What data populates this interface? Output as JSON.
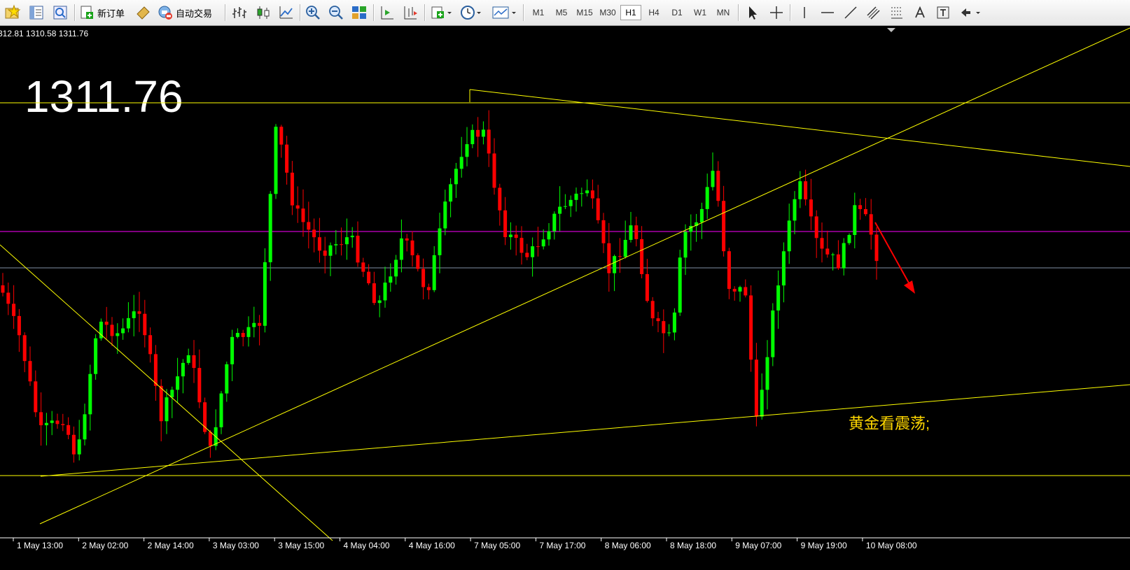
{
  "toolbar": {
    "new_order_label": "新订单",
    "auto_trade_label": "自动交易",
    "timeframes": [
      "M1",
      "M5",
      "M15",
      "M30",
      "H1",
      "H4",
      "D1",
      "W1",
      "MN"
    ],
    "active_timeframe": "H1"
  },
  "chart": {
    "ohlc_readout": "312.81 1310.58 1311.76",
    "big_price": "1311.76",
    "annotation": "黄金看震荡;",
    "time_labels": [
      "1 May 13:00",
      "2 May 02:00",
      "2 May 14:00",
      "3 May 03:00",
      "3 May 15:00",
      "4 May 04:00",
      "4 May 16:00",
      "7 May 05:00",
      "7 May 17:00",
      "8 May 06:00",
      "8 May 18:00",
      "9 May 07:00",
      "9 May 19:00",
      "10 May 08:00"
    ],
    "colors": {
      "background": "#000000",
      "bull_candle": "#00ff00",
      "bear_candle": "#ff0000",
      "trendline": "#ffff00",
      "level_magenta": "#ff00ff",
      "level_bid": "#7f8fa6",
      "arrow": "#ff0000",
      "annotation_text": "#ffd700"
    }
  }
}
